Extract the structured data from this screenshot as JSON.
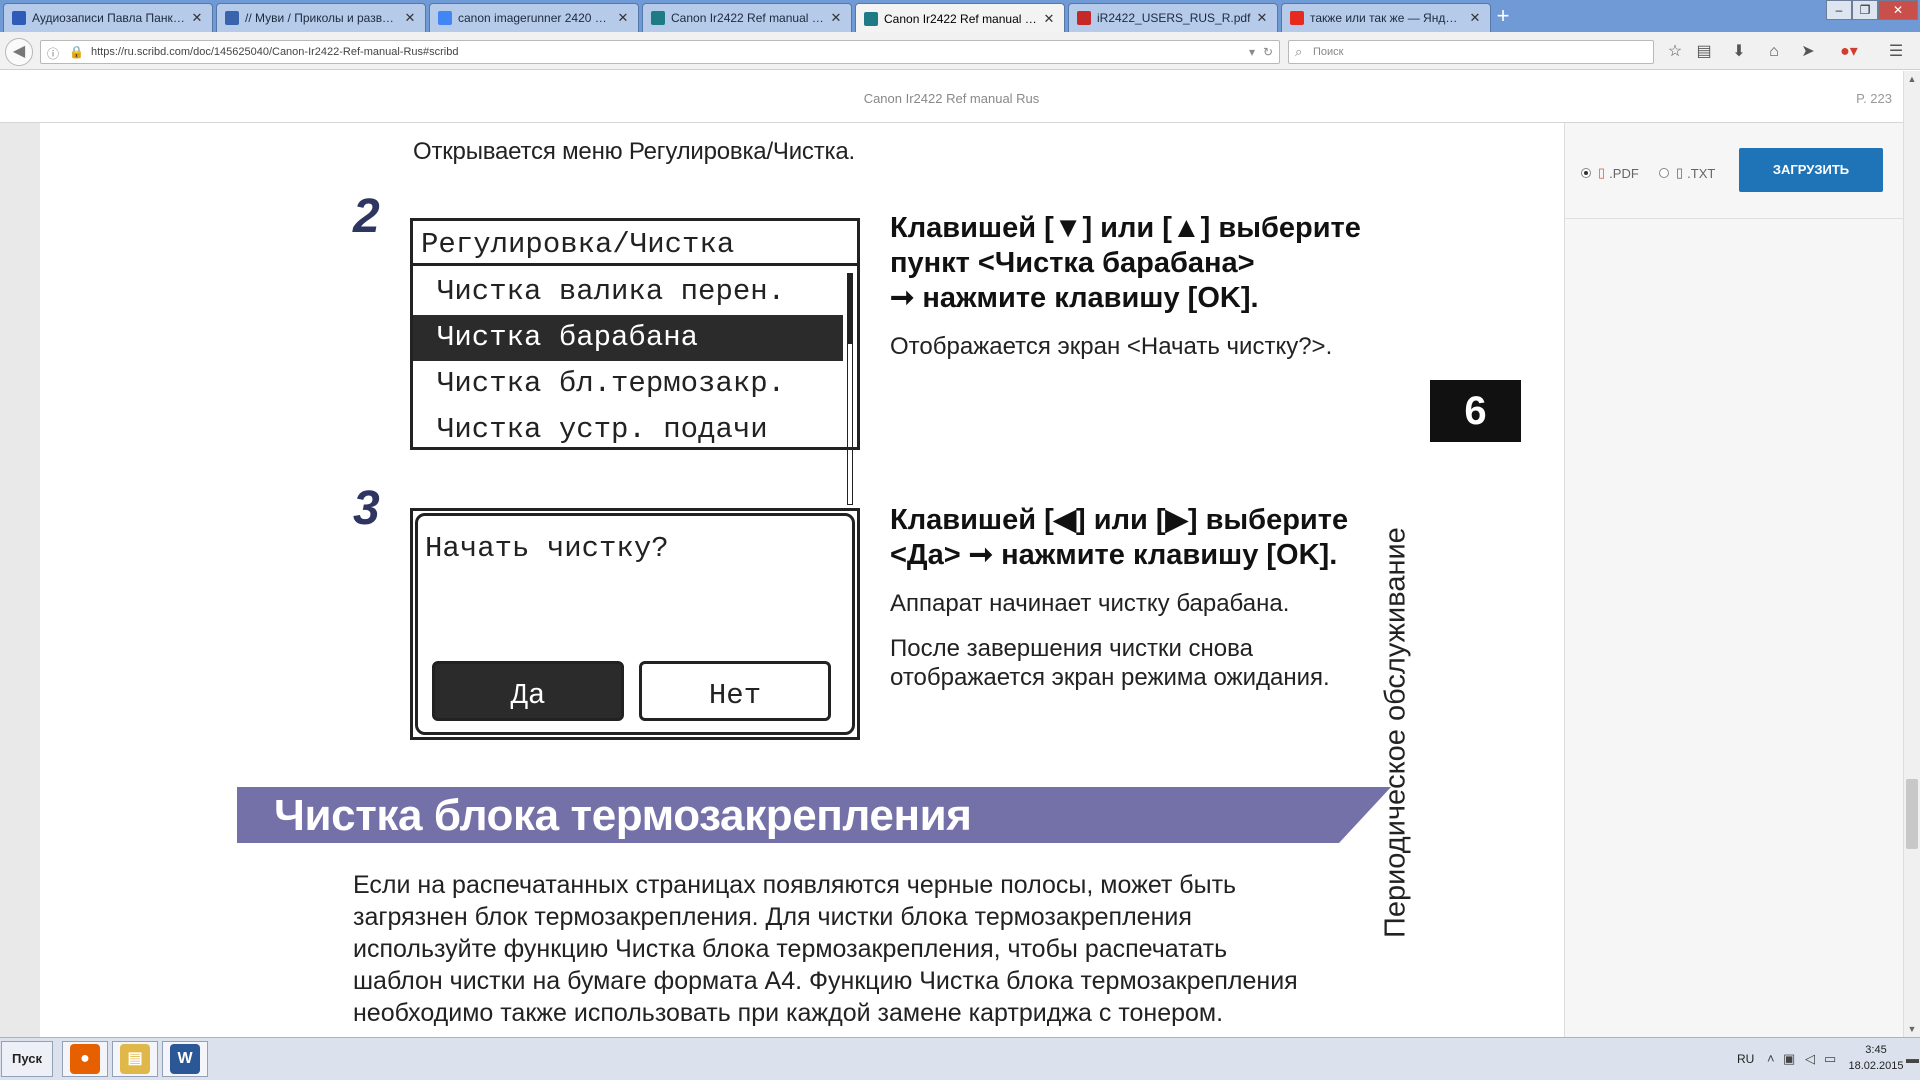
{
  "browser": {
    "tabs": [
      {
        "title": "Аудиозаписи Павла Панков...",
        "favicon": "play-icon",
        "color": "#2e5bb8"
      },
      {
        "title": "// Муви / Приколы и развле...",
        "favicon": "m-icon",
        "color": "#3a63ad"
      },
      {
        "title": "canon imagerunner 2420 спр...",
        "favicon": "google-icon",
        "color": "#4285f4"
      },
      {
        "title": "Canon Ir2422 Ref manual Rus",
        "favicon": "scribd-icon",
        "color": "#1e7b85"
      },
      {
        "title": "Canon Ir2422 Ref manual Rus",
        "favicon": "scribd-icon",
        "color": "#1e7b85",
        "active": true
      },
      {
        "title": "iR2422_USERS_RUS_R.pdf",
        "favicon": "pdf-icon",
        "color": "#c62828"
      },
      {
        "title": "также или так же — Яндек...",
        "favicon": "yandex-icon",
        "color": "#e62b1e"
      }
    ],
    "new_tab_label": "+",
    "url": "https://ru.scribd.com/doc/145625040/Canon-Ir2422-Ref-manual-Rus#scribd",
    "search_placeholder": "Поиск",
    "window_controls": {
      "minimize": "–",
      "maximize": "❐",
      "close": "✕"
    }
  },
  "doc_header": {
    "title": "Canon Ir2422 Ref manual Rus",
    "page_counter": "P. 223"
  },
  "download": {
    "formats": [
      {
        "label": ".PDF",
        "selected": true
      },
      {
        "label": ".TXT",
        "selected": false
      }
    ],
    "button_label": "ЗАГРУЗИТЬ"
  },
  "document": {
    "intro_text": "Открывается меню Регулировка/Чистка.",
    "step2": {
      "number": "2",
      "lcd_title": "Регулировка/Чистка",
      "lcd_items": [
        {
          "label": "Чистка валика перен.",
          "selected": false
        },
        {
          "label": "Чистка барабана",
          "selected": true
        },
        {
          "label": "Чистка бл.термозакр.",
          "selected": false
        },
        {
          "label": "Чистка устр. подачи",
          "selected": false
        }
      ],
      "instruction_lines": [
        "Клавишей [▼] или [▲] выберите",
        "пункт <Чистка барабана>",
        "➞ нажмите клавишу [OK]."
      ],
      "result": "Отображается экран <Начать чистку?>."
    },
    "step3": {
      "number": "3",
      "dialog_prompt": "Начать чистку?",
      "yes_label": "Да",
      "no_label": "Нет",
      "instruction_lines": [
        "Клавишей [◀] или [▶] выберите",
        "<Да> ➞ нажмите клавишу [OK]."
      ],
      "result1": "Аппарат начинает чистку барабана.",
      "result2_lines": [
        "После завершения чистки снова",
        "отображается экран режима ожидания."
      ]
    },
    "section_title": "Чистка блока термозакрепления",
    "body_lines": [
      "Если на распечатанных страницах появляются черные полосы, может быть",
      "загрязнен блок термозакрепления. Для чистки блока термозакрепления",
      "используйте функцию Чистка блока термозакрепления, чтобы распечатать",
      "шаблон чистки на бумаге формата А4. Функцию Чистка блока термозакрепления",
      "необходимо также использовать при каждой замене картриджа с тонером."
    ],
    "chapter_number": "6",
    "chapter_label": "Периодическое обслуживание"
  },
  "taskbar": {
    "start_label": "Пуск",
    "apps": [
      {
        "name": "firefox-icon",
        "glyph": "●",
        "color": "#e66000"
      },
      {
        "name": "explorer-icon",
        "glyph": "▤",
        "color": "#e0b84a"
      },
      {
        "name": "word-icon",
        "glyph": "W",
        "color": "#2b5797"
      }
    ],
    "lang": "RU",
    "time": "3:45",
    "date": "18.02.2015"
  },
  "colors": {
    "tabbar": "#6f9ad6",
    "section_banner": "#7470a8",
    "step_number": "#2d3560",
    "download_button": "#1f74b8"
  }
}
